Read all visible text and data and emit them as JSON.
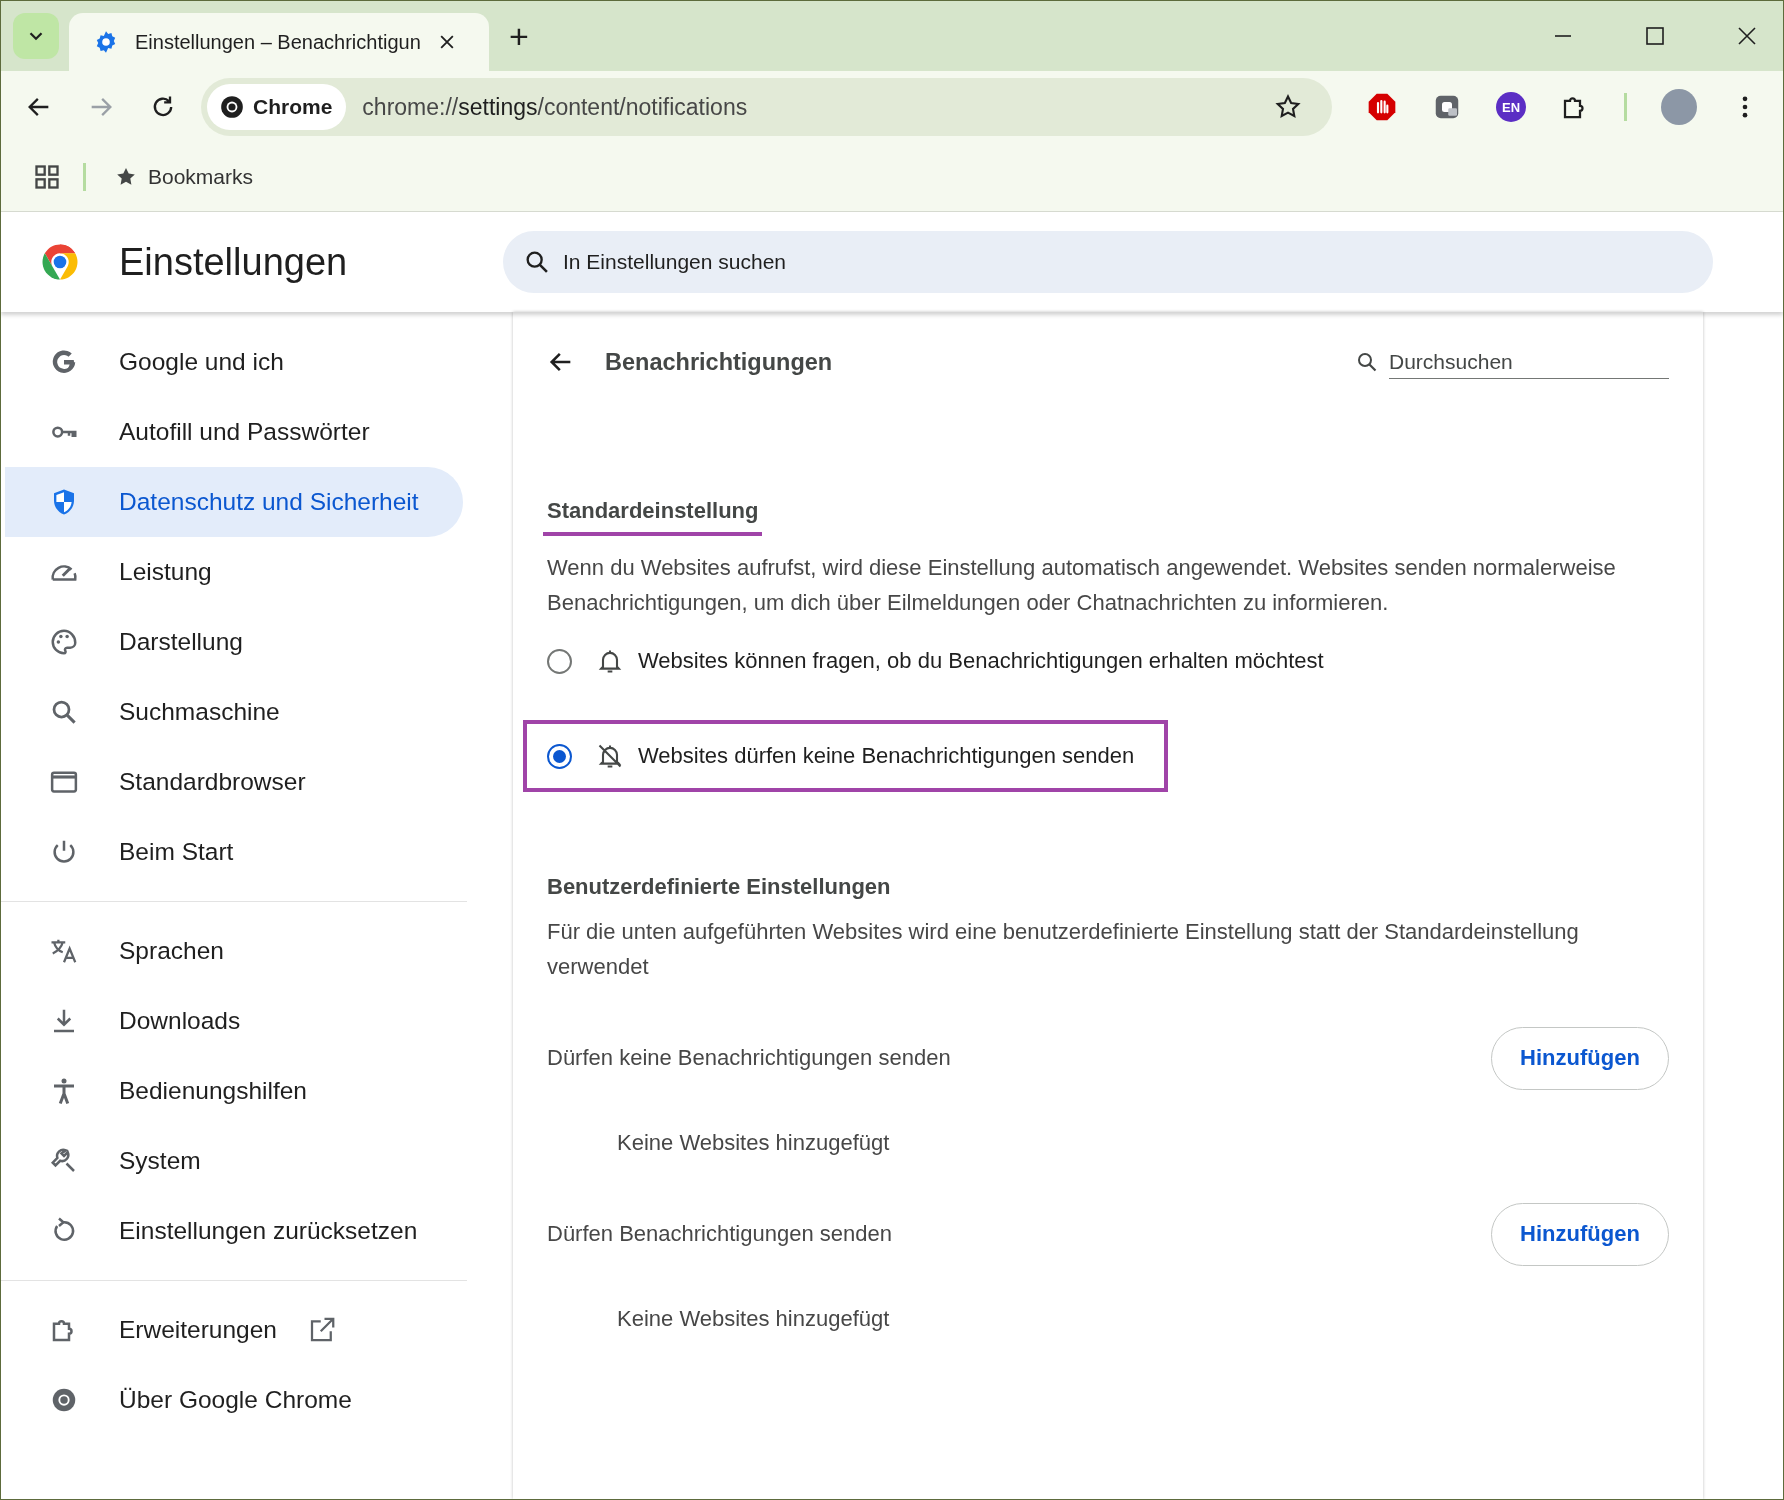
{
  "browser": {
    "tab_title": "Einstellungen – Benachrichtigun",
    "new_tab": "+",
    "site_chip": "Chrome",
    "url_scheme": "chrome://",
    "url_host": "settings",
    "url_path": "/content/notifications",
    "extension_badge": "EN",
    "bookmarks_label": "Bookmarks"
  },
  "header": {
    "title": "Einstellungen",
    "search_placeholder": "In Einstellungen suchen"
  },
  "sidebar": {
    "groups": [
      [
        {
          "label": "Google und ich",
          "kind": "google",
          "selected": false
        },
        {
          "label": "Autofill und Passwörter",
          "kind": "key",
          "selected": false
        },
        {
          "label": "Datenschutz und Sicherheit",
          "kind": "shield",
          "selected": true
        },
        {
          "label": "Leistung",
          "kind": "gauge",
          "selected": false
        },
        {
          "label": "Darstellung",
          "kind": "palette",
          "selected": false
        },
        {
          "label": "Suchmaschine",
          "kind": "search",
          "selected": false
        },
        {
          "label": "Standardbrowser",
          "kind": "browser",
          "selected": false
        },
        {
          "label": "Beim Start",
          "kind": "power",
          "selected": false
        }
      ],
      [
        {
          "label": "Sprachen",
          "kind": "translate",
          "selected": false
        },
        {
          "label": "Downloads",
          "kind": "download",
          "selected": false
        },
        {
          "label": "Bedienungshilfen",
          "kind": "accessibility",
          "selected": false
        },
        {
          "label": "System",
          "kind": "wrench",
          "selected": false
        },
        {
          "label": "Einstellungen zurücksetzen",
          "kind": "reset",
          "selected": false
        }
      ],
      [
        {
          "label": "Erweiterungen",
          "kind": "puzzle",
          "selected": false,
          "external": true
        },
        {
          "label": "Über Google Chrome",
          "kind": "chrome",
          "selected": false,
          "external": false
        }
      ]
    ]
  },
  "page": {
    "title": "Benachrichtigungen",
    "search_placeholder": "Durchsuchen",
    "default_section": {
      "heading": "Standardeinstellung",
      "highlighted": true,
      "description": "Wenn du Websites aufrufst, wird diese Einstellung automatisch angewendet. Websites senden normalerweise Benachrichtigungen, um dich über Eilmeldungen oder Chatnachrichten zu informieren.",
      "options": [
        {
          "label": "Websites können fragen, ob du Benachrichtigungen erhalten möchtest",
          "kind": "bell",
          "selected": false,
          "highlighted": false
        },
        {
          "label": "Websites dürfen keine Benachrichtigungen senden",
          "kind": "bell-off",
          "selected": true,
          "highlighted": true
        }
      ]
    },
    "custom_section": {
      "heading": "Benutzerdefinierte Einstellungen",
      "description": "Für die unten aufgeführten Websites wird eine benutzerdefinierte Einstellung statt der Standardeinstellung verwendet",
      "lists": [
        {
          "label": "Dürfen keine Benachrichtigungen senden",
          "button": "Hinzufügen",
          "empty": "Keine Websites hinzugefügt"
        },
        {
          "label": "Dürfen Benachrichtigungen senden",
          "button": "Hinzufügen",
          "empty": "Keine Websites hinzugefügt"
        }
      ]
    }
  }
}
